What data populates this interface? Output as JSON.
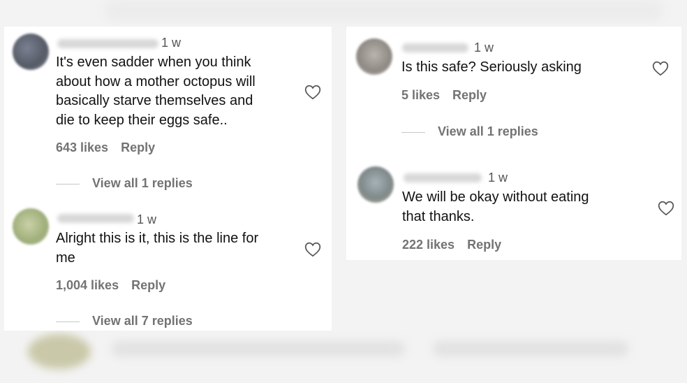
{
  "colors": {
    "secondary_text": "#737373",
    "primary_text": "#111111",
    "background": "#ffffff"
  },
  "comments": [
    {
      "time": "1 w",
      "text_lines": [
        "It's even sadder when you think",
        "about how a mother octopus will",
        "basically starve themselves and",
        "die to keep their eggs safe.."
      ],
      "likes": "643 likes",
      "reply": "Reply",
      "view_replies": "View all 1 replies",
      "icon": "heart-outline-icon"
    },
    {
      "time": "1 w",
      "text_lines": [
        "Alright this is it, this is the line for",
        "me"
      ],
      "likes": "1,004 likes",
      "reply": "Reply",
      "view_replies": "View all 7 replies",
      "icon": "heart-outline-icon"
    },
    {
      "time": "1 w",
      "text_lines": [
        "Is this safe? Seriously asking"
      ],
      "likes": "5 likes",
      "reply": "Reply",
      "view_replies": "View all 1 replies",
      "icon": "heart-outline-icon"
    },
    {
      "time": "1 w",
      "text_lines": [
        "We will be okay without eating",
        "that thanks."
      ],
      "likes": "222 likes",
      "reply": "Reply",
      "icon": "heart-outline-icon"
    }
  ]
}
